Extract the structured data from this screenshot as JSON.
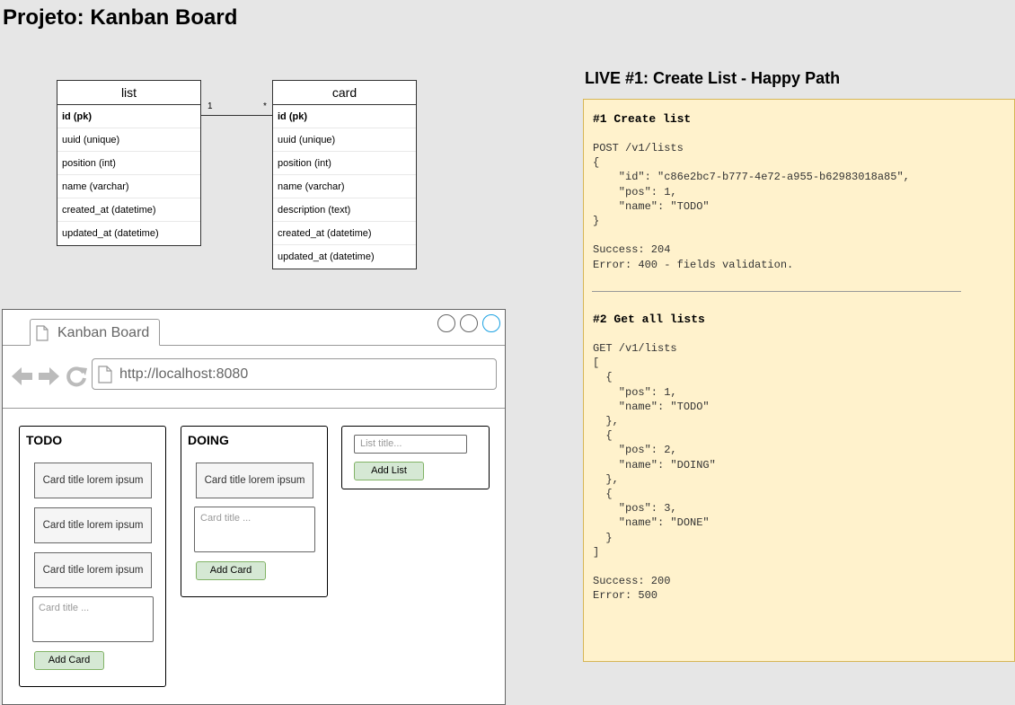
{
  "title": "Projeto: Kanban Board",
  "er": {
    "list": {
      "name": "list",
      "fields": [
        "id (pk)",
        "uuid (unique)",
        "position (int)",
        "name (varchar)",
        "created_at (datetime)",
        "updated_at (datetime)"
      ]
    },
    "card": {
      "name": "card",
      "fields": [
        "id (pk)",
        "uuid (unique)",
        "position (int)",
        "name (varchar)",
        "description (text)",
        "created_at (datetime)",
        "updated_at (datetime)"
      ]
    },
    "relation": {
      "left": "1",
      "right": "*"
    }
  },
  "browser": {
    "tab_title": "Kanban Board",
    "url": "http://localhost:8080",
    "columns": [
      {
        "title": "TODO",
        "cards": [
          "Card title lorem ipsum",
          "Card title lorem ipsum",
          "Card title lorem ipsum"
        ],
        "input_placeholder": "Card title ...",
        "button": "Add Card"
      },
      {
        "title": "DOING",
        "cards": [
          "Card title lorem ipsum"
        ],
        "input_placeholder": "Card title ...",
        "button": "Add Card"
      }
    ],
    "new_list": {
      "placeholder": "List title...",
      "button": "Add List"
    },
    "window_buttons_accent": "#1ba1e2"
  },
  "spec": {
    "title": "LIVE #1: Create List - Happy Path",
    "s1": {
      "heading": "#1 Create list",
      "body": "POST /v1/lists\n{\n    \"id\": \"c86e2bc7-b777-4e72-a955-b62983018a85\",\n    \"pos\": 1,\n    \"name\": \"TODO\"\n}\n\nSuccess: 204\nError: 400 - fields validation."
    },
    "s2": {
      "heading": "#2 Get all lists",
      "body": "GET /v1/lists\n[\n  {\n    \"pos\": 1,\n    \"name\": \"TODO\"\n  },\n  {\n    \"pos\": 2,\n    \"name\": \"DOING\"\n  },\n  {\n    \"pos\": 3,\n    \"name\": \"DONE\"\n  }\n]\n\nSuccess: 200\nError: 500"
    }
  },
  "colors": {
    "background": "#e6e6e6",
    "note_fill": "#fff2cc",
    "note_border": "#d6b656",
    "button_fill": "#d5e8d4",
    "button_border": "#82b366"
  }
}
